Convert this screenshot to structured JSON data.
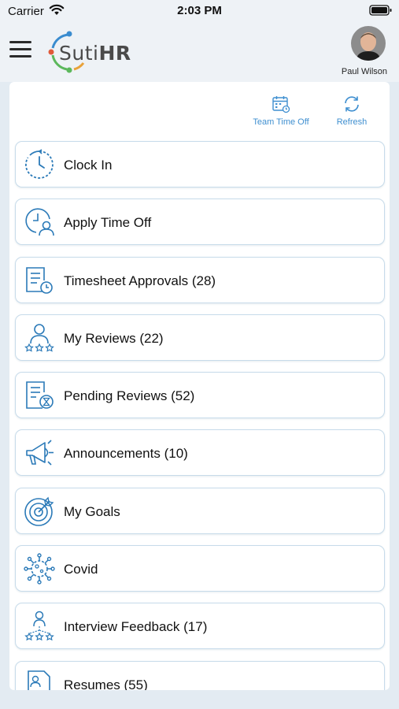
{
  "status_bar": {
    "carrier": "Carrier",
    "time": "2:03 PM"
  },
  "header": {
    "logo_text_left": "Suti",
    "logo_text_right": "HR",
    "user_name": "Paul Wilson"
  },
  "actions": {
    "team_time_off": "Team Time Off",
    "refresh": "Refresh"
  },
  "menu": [
    {
      "label": "Clock In",
      "icon": "clock-icon"
    },
    {
      "label": "Apply Time Off",
      "icon": "time-off-icon"
    },
    {
      "label": "Timesheet Approvals (28)",
      "icon": "timesheet-icon"
    },
    {
      "label": "My Reviews (22)",
      "icon": "reviews-icon"
    },
    {
      "label": "Pending Reviews (52)",
      "icon": "pending-reviews-icon"
    },
    {
      "label": "Announcements (10)",
      "icon": "megaphone-icon"
    },
    {
      "label": "My Goals",
      "icon": "target-icon"
    },
    {
      "label": "Covid",
      "icon": "virus-icon"
    },
    {
      "label": "Interview Feedback (17)",
      "icon": "interview-icon"
    },
    {
      "label": "Resumes (55)",
      "icon": "resume-icon"
    }
  ],
  "colors": {
    "accent": "#3f8fd0",
    "icon": "#2b7ab8",
    "card_border": "#c7dbea",
    "background": "#e3ebf2"
  }
}
